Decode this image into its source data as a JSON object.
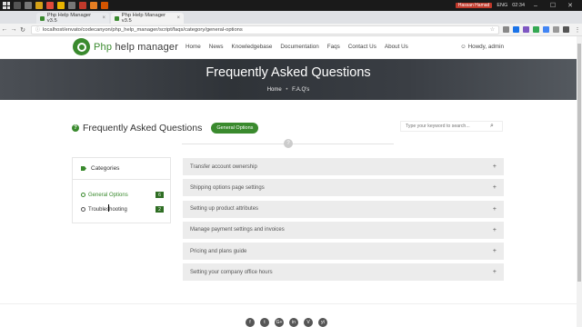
{
  "taskbar": {
    "tabs": [
      "Php Help Manager v3.5",
      "Php Help Manager v3.5"
    ],
    "user": "Hassan Hamad",
    "lang": "ENG",
    "time": "02:34"
  },
  "browser": {
    "url": "localhost/envato/codecanyon/php_help_manager/script/faqs/category/general-options"
  },
  "site": {
    "logo_a": "Php",
    "logo_b": " help manager",
    "nav": [
      "Home",
      "News",
      "Knowledgebase",
      "Documentation",
      "Faqs",
      "Contact Us",
      "About Us"
    ],
    "howdy": "Howdy, admin"
  },
  "hero": {
    "title": "Frequently Asked Questions",
    "crumb_home": "Home",
    "crumb_sep": "•",
    "crumb_current": "F.A.Q's"
  },
  "faq_header": {
    "title": "Frequently Asked Questions",
    "category_pill": "General Options",
    "search_placeholder": "Type your keyword to search..."
  },
  "categories": {
    "heading": "Categories",
    "items": [
      {
        "label": "General Options",
        "count": "6"
      },
      {
        "label": "Troubleshooting",
        "count": "2"
      }
    ]
  },
  "faqs": [
    "Transfer account ownership",
    "Shipping options page settings",
    "Setting up product attributes",
    "Manage payment settings and invoices",
    "Pricing and plans guide",
    "Setting your company office hours"
  ],
  "social": [
    "f",
    "t",
    "G+",
    "in",
    "V",
    "yt"
  ],
  "colors": {
    "accent": "#3a8a2e",
    "hero_bg": "#2f3338"
  }
}
